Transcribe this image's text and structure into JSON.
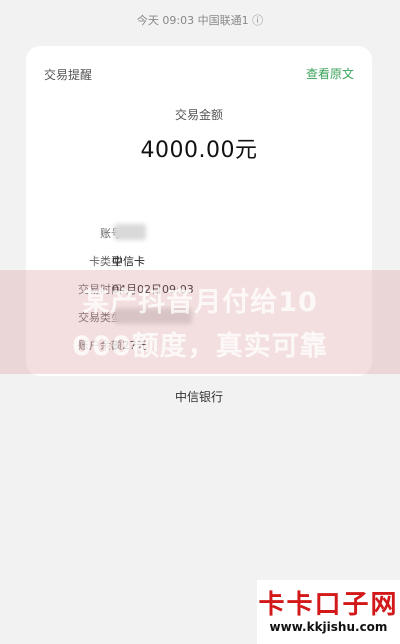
{
  "status": {
    "text": "今天 09:03 中国联通1 ⓘ"
  },
  "card": {
    "title": "交易提醒",
    "view_original": "查看原文",
    "amount_label": "交易金额",
    "amount_value": "4000.00元",
    "rows": [
      {
        "label": "账号",
        "value": ""
      },
      {
        "label": "卡类型",
        "value": "中信卡"
      },
      {
        "label": "交易时间",
        "value": "04月02日09:03"
      },
      {
        "label": "交易类型",
        "value": ""
      },
      {
        "label": "账户余额",
        "value": "3 27元"
      }
    ],
    "bank": "中信银行"
  },
  "overlay": {
    "line1": "某产抖音月付给10",
    "line2": "000额度，真实可靠"
  },
  "watermark": {
    "title": "卡卡口子网",
    "url": "www.kkjishu.com"
  }
}
